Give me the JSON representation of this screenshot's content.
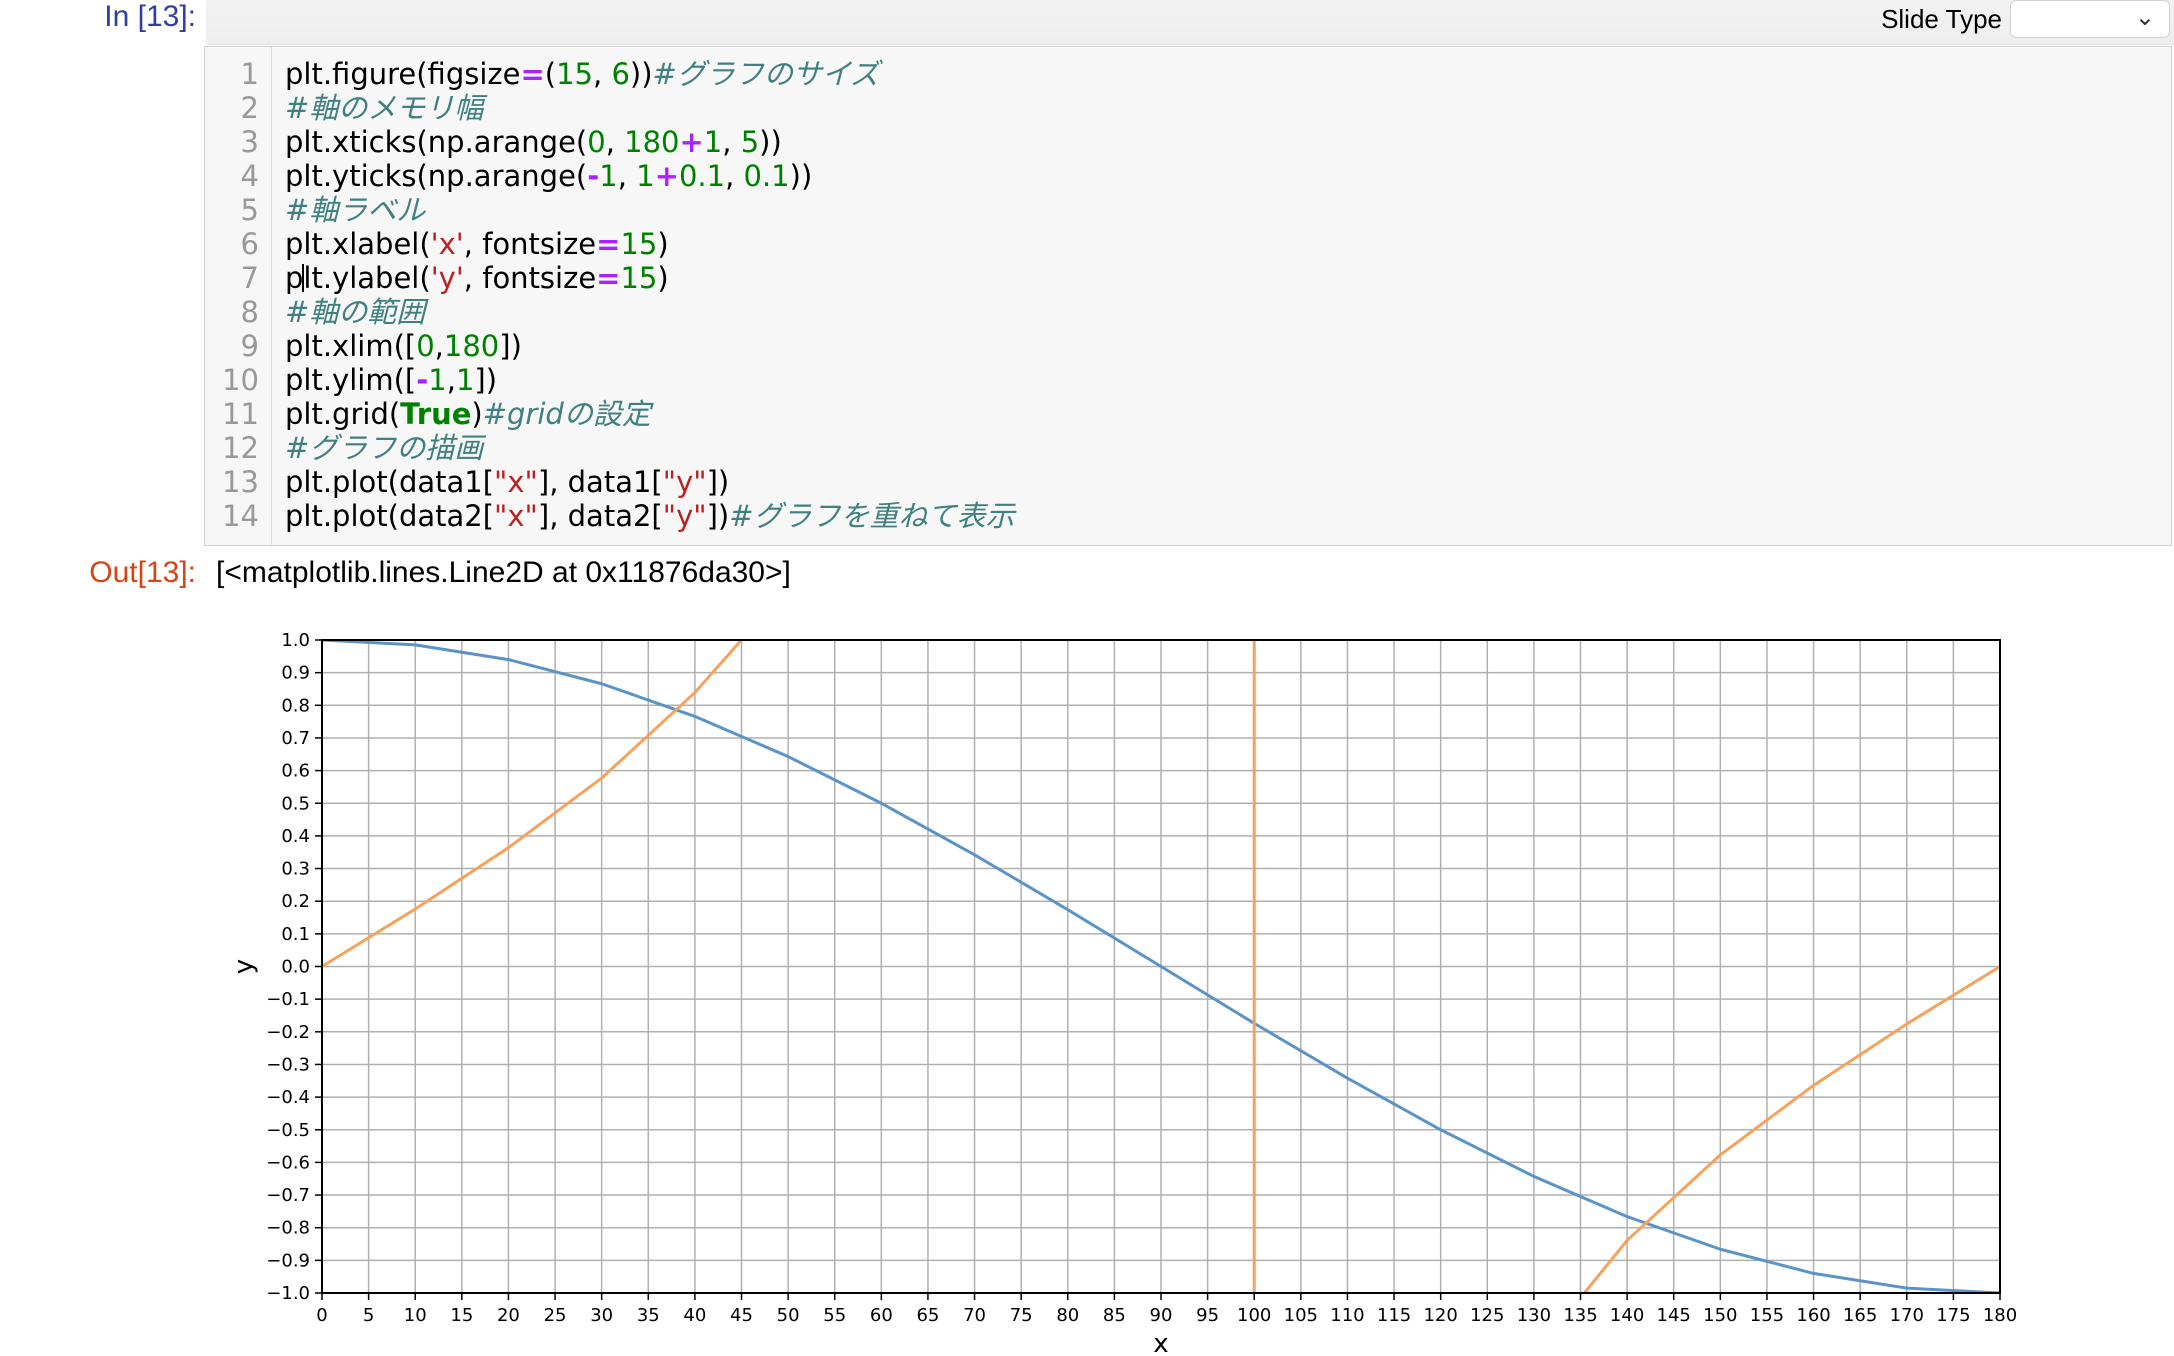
{
  "prompts": {
    "in": "In [13]:",
    "out": "Out[13]:"
  },
  "toolbar": {
    "slide_type_label": "Slide Type",
    "slide_type_value": ""
  },
  "code_lines": [
    {
      "n": "1",
      "tokens": [
        [
          "",
          "plt.figure(figsize"
        ],
        [
          "op",
          "="
        ],
        [
          "",
          "("
        ],
        [
          "nm",
          "15"
        ],
        [
          "",
          ", "
        ],
        [
          "nm",
          "6"
        ],
        [
          "",
          "))"
        ],
        [
          "cm",
          "#グラフのサイズ"
        ]
      ]
    },
    {
      "n": "2",
      "tokens": [
        [
          "cm",
          "#軸のメモリ幅"
        ]
      ]
    },
    {
      "n": "3",
      "tokens": [
        [
          "",
          "plt.xticks(np.arange("
        ],
        [
          "nm",
          "0"
        ],
        [
          "",
          ", "
        ],
        [
          "nm",
          "180"
        ],
        [
          "op",
          "+"
        ],
        [
          "nm",
          "1"
        ],
        [
          "",
          ", "
        ],
        [
          "nm",
          "5"
        ],
        [
          "",
          "))"
        ]
      ]
    },
    {
      "n": "4",
      "tokens": [
        [
          "",
          "plt.yticks(np.arange("
        ],
        [
          "op",
          "-"
        ],
        [
          "nm",
          "1"
        ],
        [
          "",
          ", "
        ],
        [
          "nm",
          "1"
        ],
        [
          "op",
          "+"
        ],
        [
          "nm",
          "0.1"
        ],
        [
          "",
          ", "
        ],
        [
          "nm",
          "0.1"
        ],
        [
          "",
          "))"
        ]
      ]
    },
    {
      "n": "5",
      "tokens": [
        [
          "cm",
          "#軸ラベル"
        ]
      ]
    },
    {
      "n": "6",
      "tokens": [
        [
          "",
          "plt.xlabel("
        ],
        [
          "st",
          "'x'"
        ],
        [
          "",
          ", fontsize"
        ],
        [
          "op",
          "="
        ],
        [
          "nm",
          "15"
        ],
        [
          "",
          ")"
        ]
      ]
    },
    {
      "n": "7",
      "tokens": [
        [
          "",
          "p"
        ],
        [
          "cursor",
          ""
        ],
        [
          "",
          "lt.ylabel("
        ],
        [
          "st",
          "'y'"
        ],
        [
          "",
          ", fontsize"
        ],
        [
          "op",
          "="
        ],
        [
          "nm",
          "15"
        ],
        [
          "",
          ")"
        ]
      ]
    },
    {
      "n": "8",
      "tokens": [
        [
          "cm",
          "#軸の範囲"
        ]
      ]
    },
    {
      "n": "9",
      "tokens": [
        [
          "",
          "plt.xlim(["
        ],
        [
          "nm",
          "0"
        ],
        [
          "",
          ","
        ],
        [
          "nm",
          "180"
        ],
        [
          "",
          "])"
        ]
      ]
    },
    {
      "n": "10",
      "tokens": [
        [
          "",
          "plt.ylim(["
        ],
        [
          "op",
          "-"
        ],
        [
          "nm",
          "1"
        ],
        [
          "",
          ","
        ],
        [
          "nm",
          "1"
        ],
        [
          "",
          "])"
        ]
      ]
    },
    {
      "n": "11",
      "tokens": [
        [
          "",
          "plt.grid("
        ],
        [
          "kw",
          "True"
        ],
        [
          "",
          ")"
        ],
        [
          "cm",
          "#gridの設定"
        ]
      ]
    },
    {
      "n": "12",
      "tokens": [
        [
          "cm",
          "#グラフの描画"
        ]
      ]
    },
    {
      "n": "13",
      "tokens": [
        [
          "",
          "plt.plot(data1["
        ],
        [
          "st",
          "\"x\""
        ],
        [
          "",
          "], data1["
        ],
        [
          "st",
          "\"y\""
        ],
        [
          "",
          "])"
        ]
      ]
    },
    {
      "n": "14",
      "tokens": [
        [
          "",
          "plt.plot(data2["
        ],
        [
          "st",
          "\"x\""
        ],
        [
          "",
          "], data2["
        ],
        [
          "st",
          "\"y\""
        ],
        [
          "",
          "])"
        ],
        [
          "cm",
          "#グラフを重ねて表示"
        ]
      ]
    }
  ],
  "output_text": "[<matplotlib.lines.Line2D at 0x11876da30>]",
  "chart_data": {
    "type": "line",
    "xlabel": "x",
    "ylabel": "y",
    "xlim": [
      0,
      180
    ],
    "ylim": [
      -1,
      1
    ],
    "grid": true,
    "xticks": [
      "0",
      "5",
      "10",
      "15",
      "20",
      "25",
      "30",
      "35",
      "40",
      "45",
      "50",
      "55",
      "60",
      "65",
      "70",
      "75",
      "80",
      "85",
      "90",
      "95",
      "100",
      "105",
      "110",
      "115",
      "120",
      "125",
      "130",
      "135",
      "140",
      "145",
      "150",
      "155",
      "160",
      "165",
      "170",
      "175",
      "180"
    ],
    "yticks": [
      "1.0",
      "0.9",
      "0.8",
      "0.7",
      "0.6",
      "0.5",
      "0.4",
      "0.3",
      "0.2",
      "0.1",
      "0.0",
      "−0.1",
      "−0.2",
      "−0.3",
      "−0.4",
      "−0.5",
      "−0.6",
      "−0.7",
      "−0.8",
      "−0.9",
      "−1.0"
    ],
    "colors": {
      "series1": "#5b93c7",
      "series2": "#f5a25d"
    },
    "series": [
      {
        "x": [
          0,
          10,
          20,
          30,
          40,
          50,
          60,
          70,
          80,
          90,
          100,
          110,
          120,
          130,
          140,
          150,
          160,
          170,
          180
        ],
        "y": [
          1.0,
          0.985,
          0.94,
          0.866,
          0.766,
          0.643,
          0.5,
          0.342,
          0.174,
          0.0,
          -0.174,
          -0.342,
          -0.5,
          -0.643,
          -0.766,
          -0.866,
          -0.94,
          -0.985,
          -1.0
        ]
      },
      {
        "x": [
          0,
          10,
          20,
          30,
          40,
          45,
          50
        ],
        "y": [
          0.0,
          0.176,
          0.364,
          0.577,
          0.839,
          1.0,
          1.19
        ]
      },
      {
        "x": [
          100,
          100
        ],
        "y": [
          1.0,
          -1.0
        ]
      },
      {
        "x": [
          130,
          140,
          150,
          160,
          170,
          180
        ],
        "y": [
          -1.19,
          -0.839,
          -0.577,
          -0.364,
          -0.176,
          0.0
        ]
      }
    ]
  }
}
